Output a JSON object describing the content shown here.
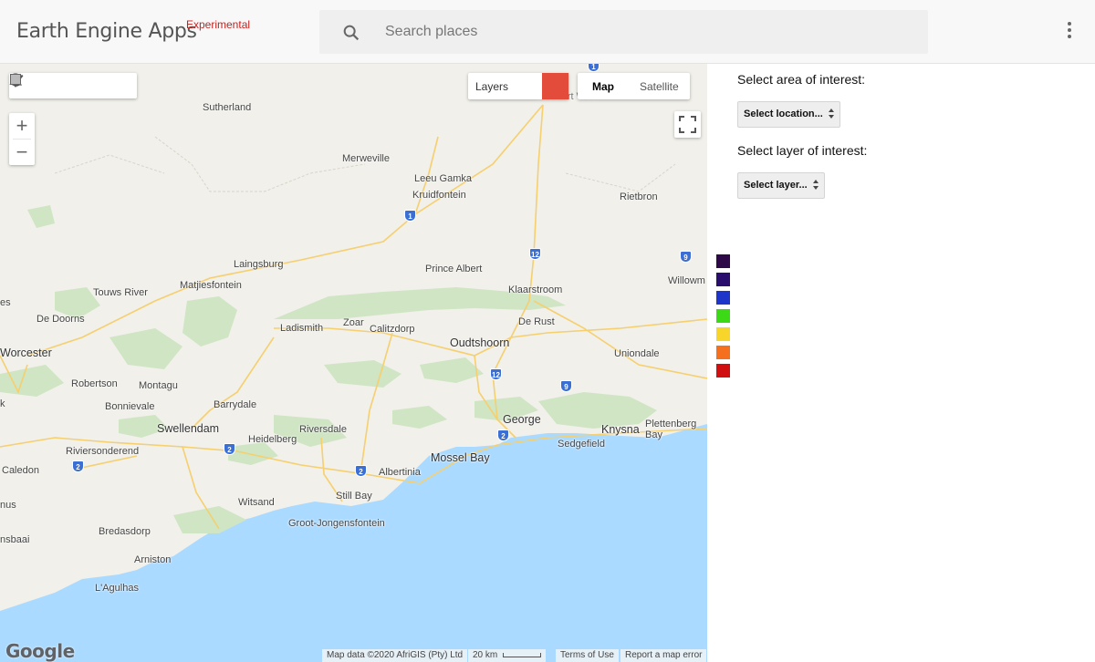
{
  "app": {
    "title": "Earth Engine Apps",
    "tag": "Experimental"
  },
  "search": {
    "placeholder": "Search places",
    "value": ""
  },
  "map": {
    "layers_label": "Layers",
    "layer_color": "#e34b3b",
    "type_options": [
      "Map",
      "Satellite"
    ],
    "selected_type": "Map",
    "logo_text": "Google",
    "attribution": "Map data ©2020 AfriGIS (Pty) Ltd",
    "scale": "20 km",
    "terms": "Terms of Use",
    "report": "Report a map error",
    "places": [
      "Sutherland",
      "Merweville",
      "Leeu Gamka",
      "Kruidfontein",
      "Rietbron",
      "Laingsburg",
      "Prince Albert",
      "Klaarstroom",
      "Willowm",
      "Touws River",
      "Matjiesfontein",
      "De Doorns",
      "Ladismith",
      "Zoar",
      "Calitzdorp",
      "De Rust",
      "Oudtshoorn",
      "Uniondale",
      "Worcester",
      "Robertson",
      "Montagu",
      "Bonnievale",
      "Barrydale",
      "Swellendam",
      "Riversdale",
      "George",
      "Knysna",
      "Plettenberg Bay",
      "Sedgefield",
      "Heidelberg",
      "Mossel Bay",
      "Albertinia",
      "Riviersonderend",
      "Caledon",
      "Still Bay",
      "Witsand",
      "Groot-Jongensfontein",
      "Bredasdorp",
      "Arniston",
      "L'Agulhas",
      "es",
      "nus",
      "nsbaai",
      "k",
      "Beaufort West"
    ],
    "route_numbers": [
      "1",
      "12",
      "9",
      "12",
      "9",
      "2",
      "2",
      "2",
      "2",
      "1"
    ]
  },
  "panel": {
    "area_label": "Select area of interest:",
    "area_select": "Select location...",
    "layer_label": "Select layer of interest:",
    "layer_select": "Select layer..."
  },
  "legend_colors": [
    "#2d0a47",
    "#2a0e6e",
    "#1e35c9",
    "#3cd916",
    "#f7d52a",
    "#f4701f",
    "#d01010"
  ],
  "tools": [
    "hand-icon",
    "marker-icon",
    "polyline-icon",
    "polygon-icon",
    "rectangle-icon"
  ]
}
